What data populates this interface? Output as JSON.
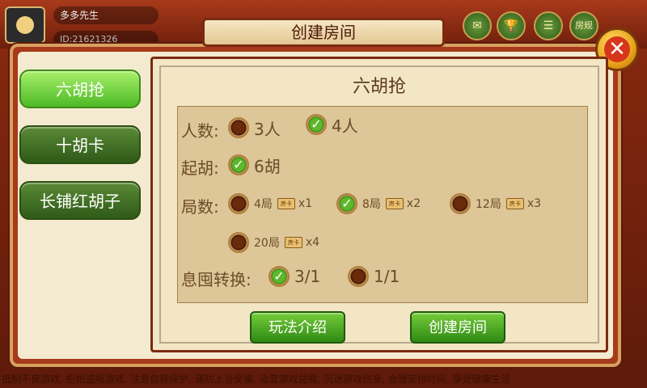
{
  "header": {
    "user_name": "多多先生",
    "user_id": "ID:21621326",
    "icons": [
      "mail-icon",
      "trophy-icon",
      "notice-icon",
      "rules-icon"
    ],
    "rules_label": "房规"
  },
  "dialog": {
    "title": "创建房间",
    "close_icon": "close-icon"
  },
  "tabs": [
    {
      "label": "六胡抢",
      "active": true
    },
    {
      "label": "十胡卡",
      "active": false
    },
    {
      "label": "长铺红胡子",
      "active": false
    }
  ],
  "panel": {
    "title": "六胡抢",
    "rows": {
      "players": {
        "label": "人数:",
        "options": [
          {
            "text": "3人",
            "checked": false
          },
          {
            "text": "4人",
            "checked": true
          }
        ]
      },
      "hu": {
        "label": "起胡:",
        "options": [
          {
            "text": "6胡",
            "checked": true
          }
        ]
      },
      "rounds": {
        "label": "局数:",
        "options": [
          {
            "text": "4局",
            "card": "房卡",
            "mult": "x1",
            "checked": false
          },
          {
            "text": "8局",
            "card": "房卡",
            "mult": "x2",
            "checked": true
          },
          {
            "text": "12局",
            "card": "房卡",
            "mult": "x3",
            "checked": false
          },
          {
            "text": "20局",
            "card": "房卡",
            "mult": "x4",
            "checked": false
          }
        ]
      },
      "conversion": {
        "label": "息囤转换:",
        "options": [
          {
            "text": "3/1",
            "checked": true
          },
          {
            "text": "1/1",
            "checked": false
          }
        ]
      }
    },
    "buttons": {
      "intro": "玩法介绍",
      "create": "创建房间"
    }
  },
  "notice": "抵制不良游戏, 拒绝盗版游戏, 注意自我保护, 谨防上当受骗, 适度游戏益脑, 沉迷游戏伤身, 合理安排时间, 享受健康生活"
}
